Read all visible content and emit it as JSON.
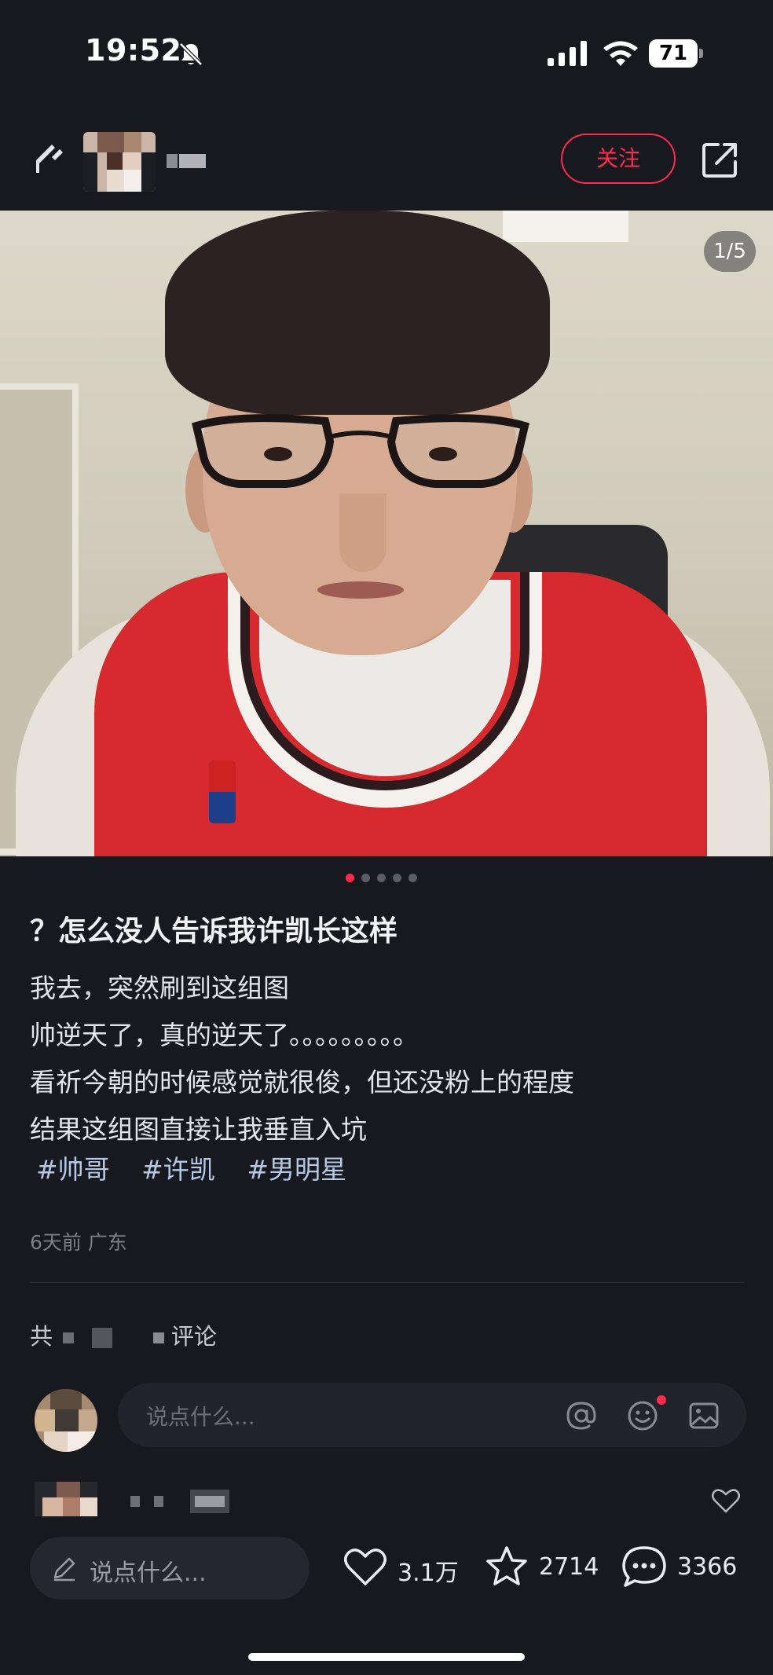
{
  "status_bar": {
    "time": "19:52",
    "battery": "71",
    "icons": [
      "bell-off-icon",
      "cellular-signal-icon",
      "wifi-icon",
      "battery-icon"
    ]
  },
  "header": {
    "follow_label": "关注",
    "icons": [
      "back-icon",
      "share-icon"
    ]
  },
  "media": {
    "page_indicator": "1/5",
    "current_page": 1,
    "total_pages": 5
  },
  "post": {
    "title": "？怎么没人告诉我许凯长这样",
    "lines": [
      "我去，突然刷到这组图",
      "帅逆天了，真的逆天了。。。。。。。。。",
      "看祈今朝的时候感觉就很俊，但还没粉上的程度",
      "结果这组图直接让我垂直入坑"
    ],
    "tags": [
      "#帅哥",
      "#许凯",
      "#男明星"
    ],
    "meta": "6天前 广东"
  },
  "comments": {
    "count_prefix": "共",
    "count_suffix": "评论",
    "input_placeholder": "说点什么..."
  },
  "bottom_bar": {
    "input_placeholder": "说点什么...",
    "likes": "3.1万",
    "favorites": "2714",
    "comments": "3366"
  },
  "colors": {
    "accent": "#ff2a4d",
    "background": "#18181f",
    "tag": "#b5c8e6"
  }
}
